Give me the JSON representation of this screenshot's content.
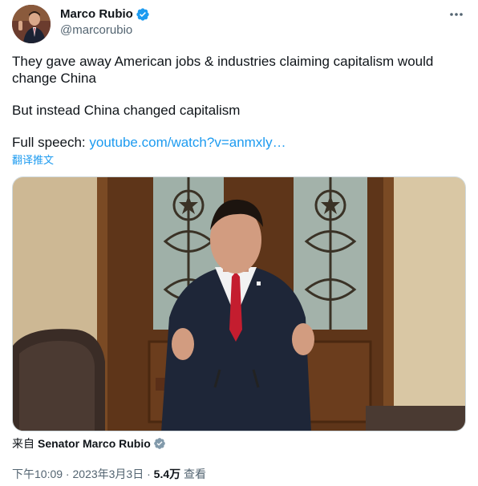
{
  "author": {
    "display_name": "Marco Rubio",
    "handle": "@marcorubio",
    "verified_color": "#1d9bf0"
  },
  "tweet": {
    "paragraph1": "They gave away American jobs & industries claiming capitalism would change China",
    "paragraph2": "But instead China changed capitalism",
    "paragraph3_prefix": "Full speech: ",
    "link_text": "youtube.com/watch?v=anmxly…",
    "translate_label": "翻译推文"
  },
  "source": {
    "from_label": "来自",
    "account_name": "Senator Marco Rubio"
  },
  "meta": {
    "time": "下午10:09",
    "separator": " · ",
    "date": "2023年3月3日",
    "views_count": "5.4万",
    "views_label": " 查看"
  },
  "icons": {
    "more": "more-icon",
    "verified": "verified-badge-icon",
    "gray_badge": "gray-verified-badge-icon"
  }
}
